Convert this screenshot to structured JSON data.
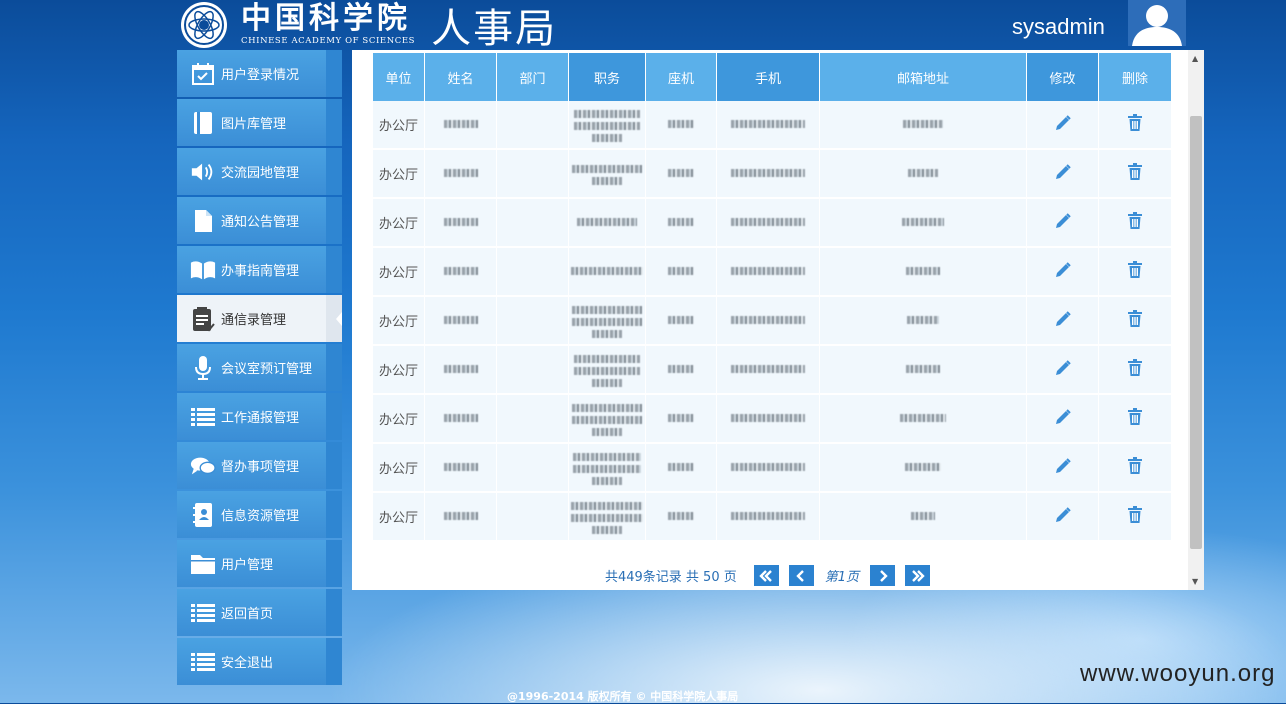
{
  "header": {
    "org_cn": "中国科学院",
    "org_en": "CHINESE ACADEMY OF SCIENCES",
    "dept": "人事局",
    "username": "sysadmin"
  },
  "sidebar": {
    "items": [
      {
        "label": "用户登录情况",
        "icon": "calendar-check-icon"
      },
      {
        "label": "图片库管理",
        "icon": "book-icon"
      },
      {
        "label": "交流园地管理",
        "icon": "speaker-icon"
      },
      {
        "label": "通知公告管理",
        "icon": "document-icon"
      },
      {
        "label": "办事指南管理",
        "icon": "open-book-icon"
      },
      {
        "label": "通信录管理",
        "icon": "clipboard-icon"
      },
      {
        "label": "会议室预订管理",
        "icon": "microphone-icon"
      },
      {
        "label": "工作通报管理",
        "icon": "list-icon"
      },
      {
        "label": "督办事项管理",
        "icon": "chat-icon"
      },
      {
        "label": "信息资源管理",
        "icon": "contact-book-icon"
      },
      {
        "label": "用户管理",
        "icon": "folder-icon"
      },
      {
        "label": "返回首页",
        "icon": "list-icon"
      },
      {
        "label": "安全退出",
        "icon": "list-icon"
      }
    ],
    "active_index": 5
  },
  "table": {
    "headers": [
      "单位",
      "姓名",
      "部门",
      "职务",
      "座机",
      "手机",
      "邮箱地址",
      "修改",
      "删除"
    ],
    "rows": [
      {
        "unit": "办公厅"
      },
      {
        "unit": "办公厅"
      },
      {
        "unit": "办公厅"
      },
      {
        "unit": "办公厅"
      },
      {
        "unit": "办公厅"
      },
      {
        "unit": "办公厅"
      },
      {
        "unit": "办公厅"
      },
      {
        "unit": "办公厅"
      },
      {
        "unit": "办公厅"
      }
    ]
  },
  "pager": {
    "info": "共449条记录 共 50 页",
    "current": "第1页"
  },
  "footer": "@1996-2014 版权所有 © 中国科学院人事局",
  "watermark": "www.wooyun.org",
  "colors": {
    "accent": "#3e97dc",
    "header_light": "#5bb0ea",
    "row_bg": "#f1f8fd",
    "icon_blue": "#3b8ed6"
  }
}
